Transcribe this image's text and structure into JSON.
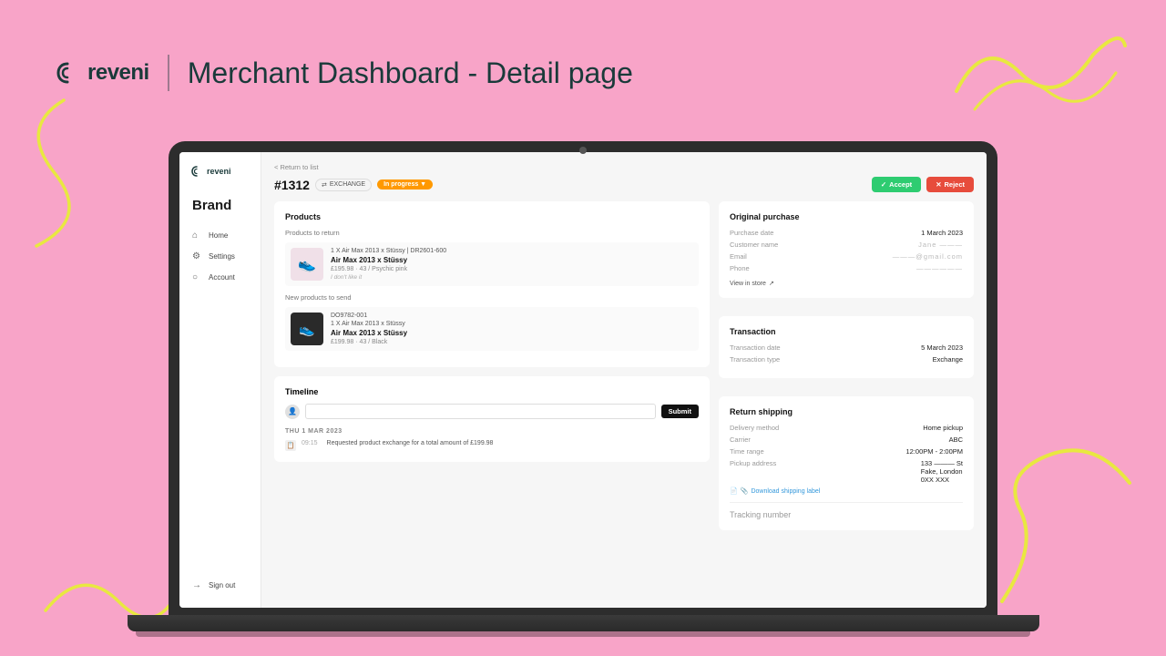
{
  "page": {
    "logo": "reveni",
    "divider": "|",
    "title": "Merchant Dashboard - Detail page"
  },
  "sidebar": {
    "logo": "reveni",
    "brand": "Brand",
    "nav": [
      {
        "label": "Home",
        "icon": "🏠"
      },
      {
        "label": "Settings",
        "icon": "⚙"
      },
      {
        "label": "Account",
        "icon": "👤"
      }
    ],
    "signout": "Sign out"
  },
  "detail": {
    "back_link": "< Return to list",
    "order_id": "#1312",
    "exchange_label": "EXCHANGE",
    "status": "In progress ▼",
    "accept_btn": "Accept",
    "reject_btn": "Reject",
    "products_card": {
      "title": "Products",
      "return_section": "Products to return",
      "return_items": [
        {
          "qty_sku": "1 X  Air Max 2013 x Stüssy  |  DR2601-600",
          "name": "Air Max 2013 x Stüssy",
          "price": "£195.98",
          "meta": "43 / Psychic pink",
          "reason": "I don't like it"
        }
      ],
      "new_section": "New products to send",
      "new_items": [
        {
          "sku": "DO9782-001",
          "qty_sku": "1 X  Air Max 2013 x Stüssy",
          "name": "Air Max 2013 x Stüssy",
          "price": "£199.98",
          "meta": "43 / Black"
        }
      ]
    },
    "timeline": {
      "title": "Timeline",
      "input_placeholder": "",
      "submit_btn": "Submit",
      "date_label": "THU 1 MAR 2023",
      "events": [
        {
          "time": "09:15",
          "text": "Requested product exchange for a total amount of £199.98"
        }
      ]
    },
    "original_purchase": {
      "title": "Original purchase",
      "purchase_date_label": "Purchase date",
      "purchase_date": "1 March 2023",
      "customer_name_label": "Customer name",
      "customer_name": "Jane ———",
      "email_label": "Email",
      "email": "———@gmail.com",
      "phone_label": "Phone",
      "phone": "——————",
      "view_in_store": "View in store"
    },
    "transaction": {
      "title": "Transaction",
      "date_label": "Transaction date",
      "date": "5 March 2023",
      "type_label": "Transaction type",
      "type": "Exchange"
    },
    "return_shipping": {
      "title": "Return shipping",
      "delivery_method_label": "Delivery method",
      "delivery_method": "Home pickup",
      "carrier_label": "Carrier",
      "carrier": "ABC",
      "time_label": "Time range",
      "time": "12:00PM - 2:00PM",
      "address_label": "Pickup address",
      "address_line1": "133 ——— St",
      "address_line2": "Fake, London",
      "address_line3": "0XX XXX",
      "download_label": "Download shipping label",
      "tracking_label": "Tracking number"
    }
  }
}
